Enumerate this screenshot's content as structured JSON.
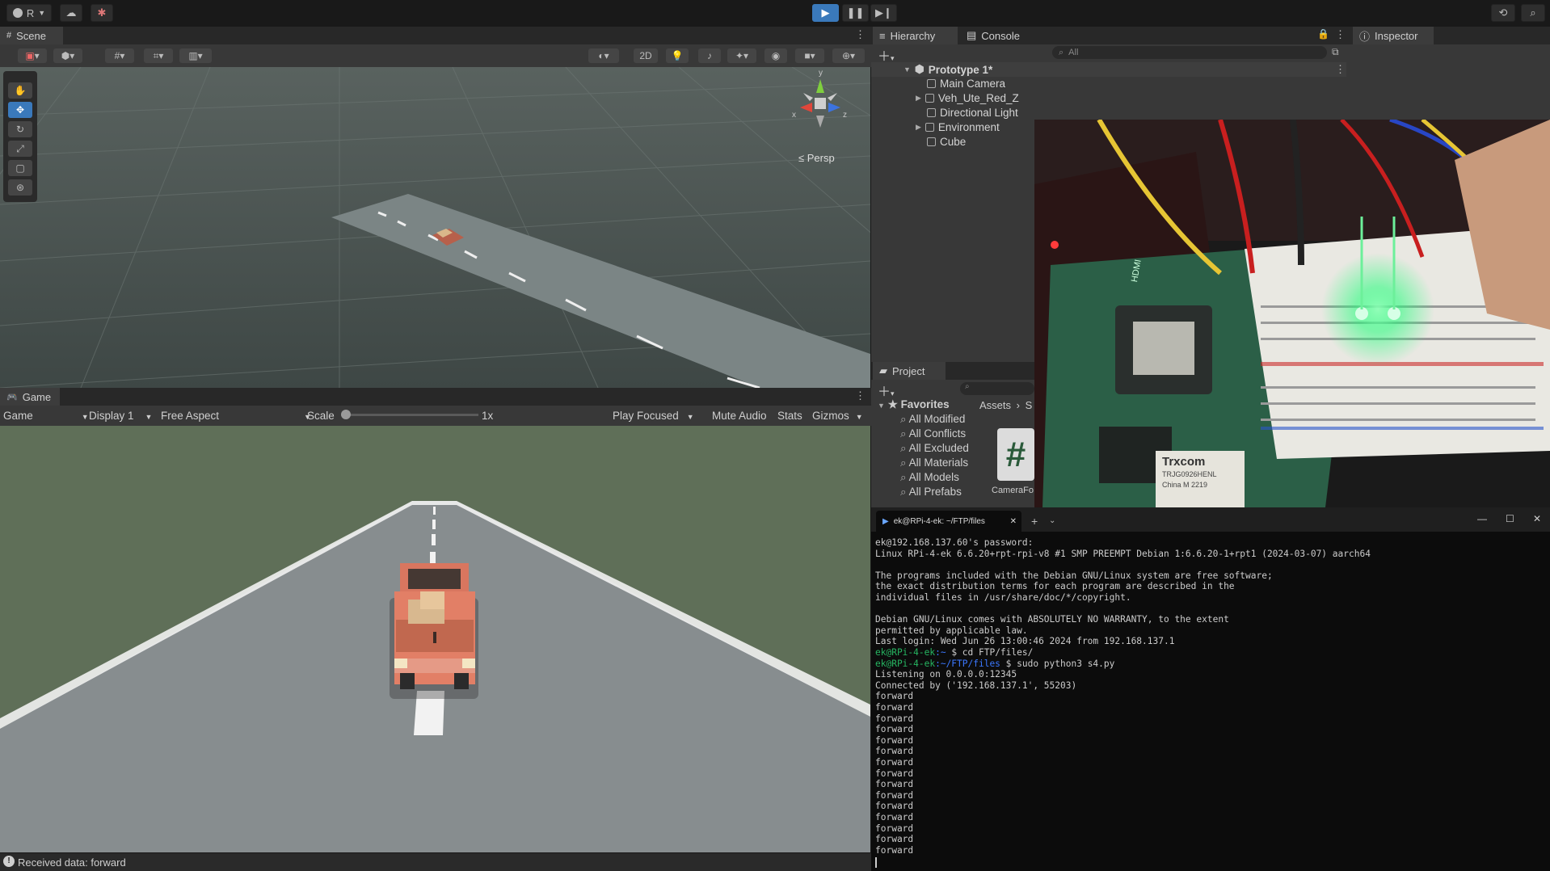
{
  "topbar": {
    "account_label": "R",
    "play_icon": "play-icon",
    "pause_icon": "pause-icon",
    "step_icon": "step-icon"
  },
  "scene": {
    "tab_label": "Scene",
    "persp_label": "Persp",
    "toggle_2d": "2D",
    "gizmo_axis_y": "y",
    "gizmo_axis_x": "x",
    "gizmo_axis_z": "z"
  },
  "game": {
    "tab_label": "Game",
    "mode": "Game",
    "display": "Display 1",
    "aspect": "Free Aspect",
    "scale_label": "Scale",
    "scale_value": "1x",
    "play_focused": "Play Focused",
    "mute_audio": "Mute Audio",
    "stats": "Stats",
    "gizmos": "Gizmos"
  },
  "hierarchy": {
    "tab_label": "Hierarchy",
    "console_tab": "Console",
    "search_placeholder": "All",
    "root": "Prototype 1*",
    "items": [
      {
        "label": "Main Camera",
        "expandable": false
      },
      {
        "label": "Veh_Ute_Red_Z",
        "expandable": true
      },
      {
        "label": "Directional Light",
        "expandable": false
      },
      {
        "label": "Environment",
        "expandable": true
      },
      {
        "label": "Cube",
        "expandable": false
      }
    ]
  },
  "inspector": {
    "tab_label": "Inspector"
  },
  "project": {
    "tab_label": "Project",
    "favorites_label": "Favorites",
    "favorites": [
      "All Modified",
      "All Conflicts",
      "All Excluded",
      "All Materials",
      "All Models",
      "All Prefabs"
    ],
    "breadcrumb": "Assets",
    "breadcrumb_next": "S",
    "asset_icon_glyph": "#",
    "asset_name": "CameraFo"
  },
  "photo": {
    "board_labels": [
      "HDMI",
      "Trxcom",
      "TRJG0926HENL",
      "China M 2219"
    ]
  },
  "terminal": {
    "tab_title": "ek@RPi-4-ek: ~/FTP/files",
    "lines": [
      {
        "text": "ek@192.168.137.60's password:"
      },
      {
        "text": "Linux RPi-4-ek 6.6.20+rpt-rpi-v8 #1 SMP PREEMPT Debian 1:6.6.20-1+rpt1 (2024-03-07) aarch64"
      },
      {
        "text": ""
      },
      {
        "text": "The programs included with the Debian GNU/Linux system are free software;"
      },
      {
        "text": "the exact distribution terms for each program are described in the"
      },
      {
        "text": "individual files in /usr/share/doc/*/copyright."
      },
      {
        "text": ""
      },
      {
        "text": "Debian GNU/Linux comes with ABSOLUTELY NO WARRANTY, to the extent"
      },
      {
        "text": "permitted by applicable law."
      },
      {
        "text": "Last login: Wed Jun 26 13:00:46 2024 from 192.168.137.1"
      },
      {
        "user": "ek@RPi-4-ek",
        "path": ":~",
        "cmd": " $ cd FTP/files/"
      },
      {
        "user": "ek@RPi-4-ek",
        "path": ":~/FTP/files",
        "cmd": " $ sudo python3 s4.py"
      },
      {
        "text": "Listening on 0.0.0.0:12345"
      },
      {
        "text": "Connected by ('192.168.137.1', 55203)"
      },
      {
        "text": "forward"
      },
      {
        "text": "forward"
      },
      {
        "text": "forward"
      },
      {
        "text": "forward"
      },
      {
        "text": "forward"
      },
      {
        "text": "forward"
      },
      {
        "text": "forward"
      },
      {
        "text": "forward"
      },
      {
        "text": "forward"
      },
      {
        "text": "forward"
      },
      {
        "text": "forward"
      },
      {
        "text": "forward"
      },
      {
        "text": "forward"
      },
      {
        "text": "forward"
      },
      {
        "text": "forward"
      }
    ]
  },
  "status": {
    "message": "Received data: forward"
  },
  "colors": {
    "accent": "#3a79bb",
    "terminal_user": "#26b561",
    "terminal_path": "#3b78ff",
    "led_green": "#21ff7a"
  }
}
